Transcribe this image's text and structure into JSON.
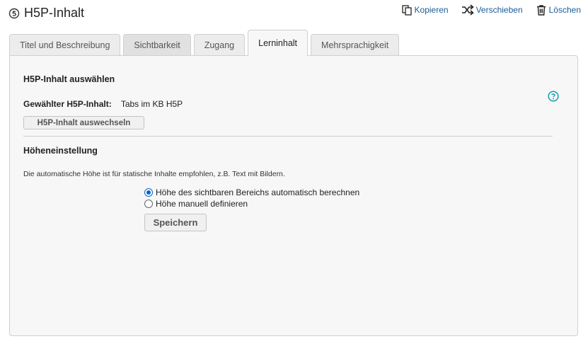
{
  "header": {
    "title": "H5P-Inhalt"
  },
  "actions": [
    {
      "label": "Kopieren",
      "icon": "copy-icon"
    },
    {
      "label": "Verschieben",
      "icon": "shuffle-icon"
    },
    {
      "label": "Löschen",
      "icon": "trash-icon"
    }
  ],
  "tabs": [
    {
      "label": "Titel und Beschreibung",
      "active": false
    },
    {
      "label": "Sichtbarkeit",
      "active": false
    },
    {
      "label": "Zugang",
      "active": false
    },
    {
      "label": "Lerninhalt",
      "active": true
    },
    {
      "label": "Mehrsprachigkeit",
      "active": false
    }
  ],
  "content": {
    "select_title": "H5P-Inhalt auswählen",
    "selected_label": "Gewählter H5P-Inhalt:",
    "selected_value": "Tabs im KB H5P",
    "switch_button": "H5P-Inhalt auswechseln",
    "height_title": "Höheneinstellung",
    "height_desc": "Die automatische Höhe ist für statische Inhalte empfohlen, z.B. Text mit Bildern.",
    "radio_auto": "Höhe des sichtbaren Bereichs automatisch berechnen",
    "radio_manual": "Höhe manuell definieren",
    "selected_option": "auto",
    "save_button": "Speichern"
  },
  "colors": {
    "accent": "#1a5a94",
    "help": "#1a9bb3",
    "radio": "#0a64c8"
  }
}
